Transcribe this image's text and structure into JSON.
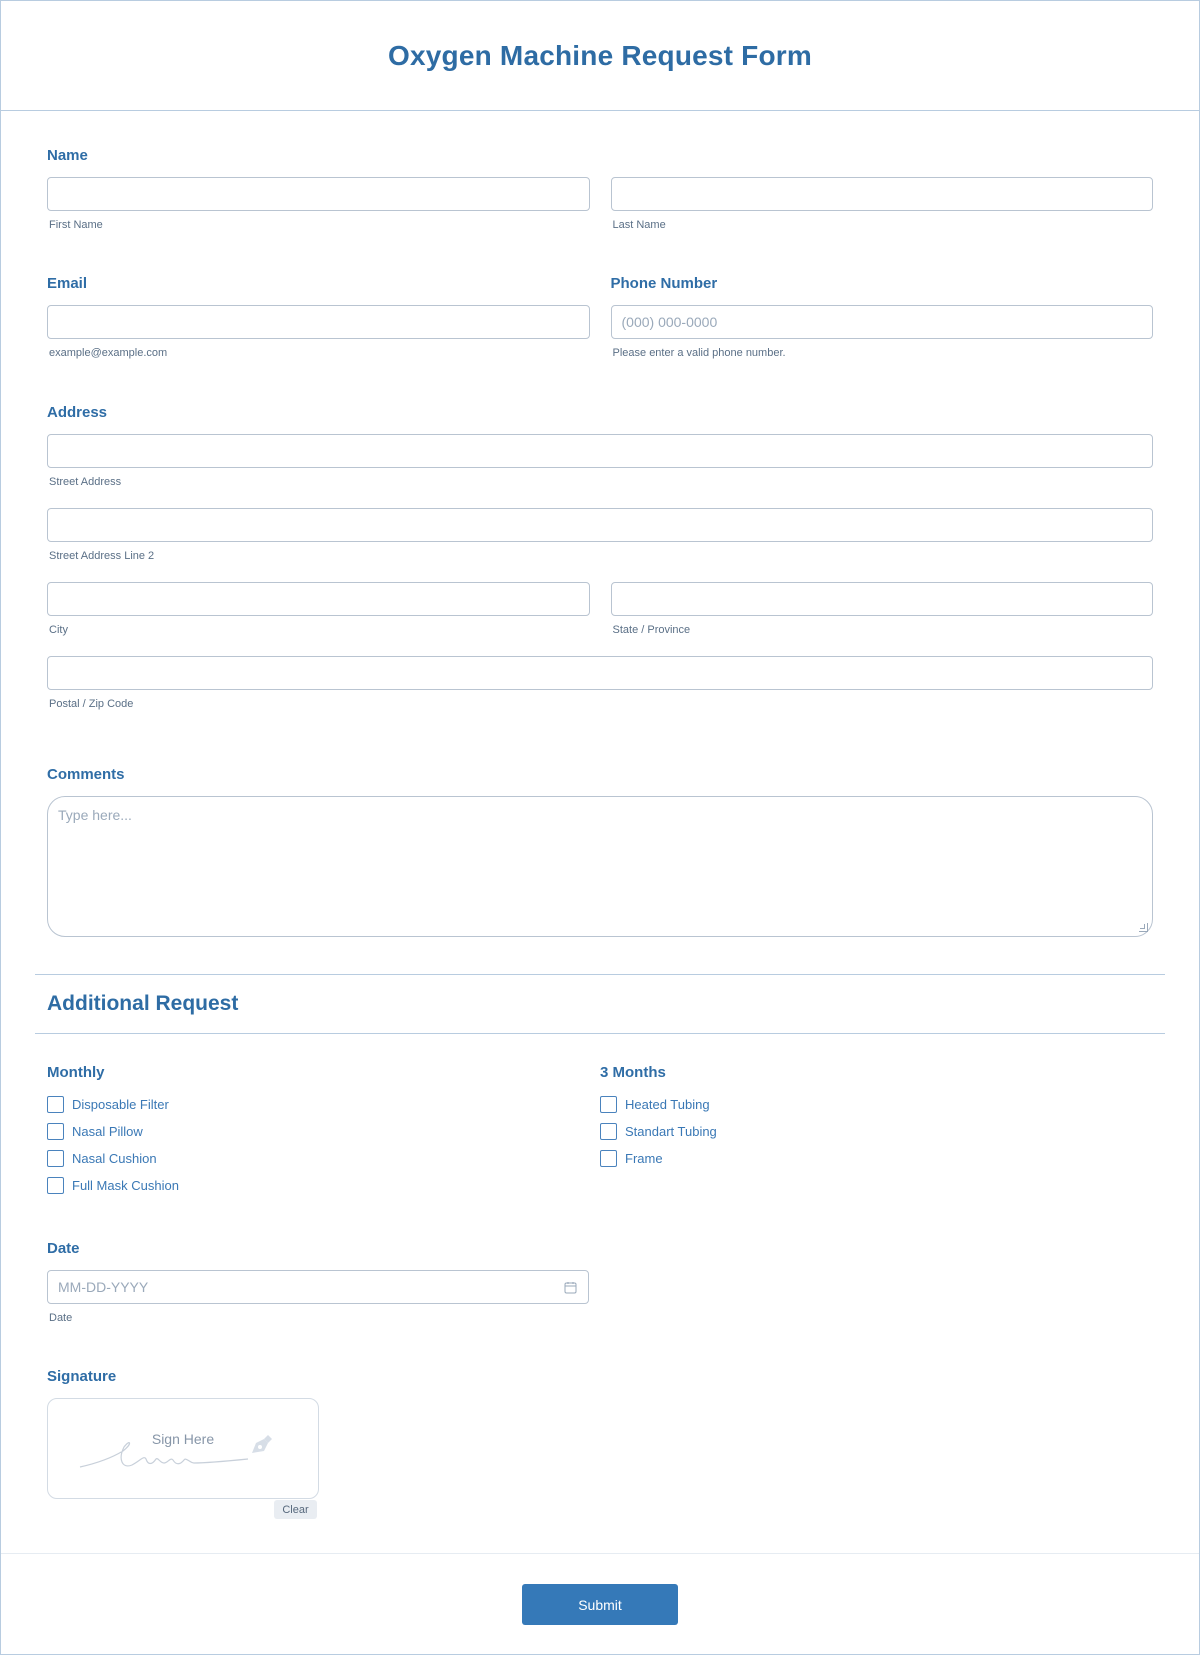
{
  "form": {
    "title": "Oxygen Machine Request Form"
  },
  "name": {
    "label": "Name",
    "first_sublabel": "First Name",
    "last_sublabel": "Last Name"
  },
  "email": {
    "label": "Email",
    "sublabel": "example@example.com"
  },
  "phone": {
    "label": "Phone Number",
    "placeholder": "(000) 000-0000",
    "sublabel": "Please enter a valid phone number."
  },
  "address": {
    "label": "Address",
    "street_sublabel": "Street Address",
    "street2_sublabel": "Street Address Line 2",
    "city_sublabel": "City",
    "state_sublabel": "State / Province",
    "zip_sublabel": "Postal / Zip Code"
  },
  "comments": {
    "label": "Comments",
    "placeholder": "Type here..."
  },
  "additional": {
    "title": "Additional Request",
    "monthly": {
      "label": "Monthly",
      "items": [
        "Disposable Filter",
        "Nasal Pillow",
        "Nasal Cushion",
        "Full Mask Cushion"
      ]
    },
    "three_months": {
      "label": "3 Months",
      "items": [
        "Heated Tubing",
        "Standart Tubing",
        "Frame"
      ]
    }
  },
  "date": {
    "label": "Date",
    "placeholder": "MM-DD-YYYY",
    "sublabel": "Date"
  },
  "signature": {
    "label": "Signature",
    "hint": "Sign Here",
    "clear_label": "Clear"
  },
  "footer": {
    "submit_label": "Submit"
  },
  "colors": {
    "accent": "#3579b8",
    "label": "#2f6da6",
    "border": "#b9c4d1"
  }
}
